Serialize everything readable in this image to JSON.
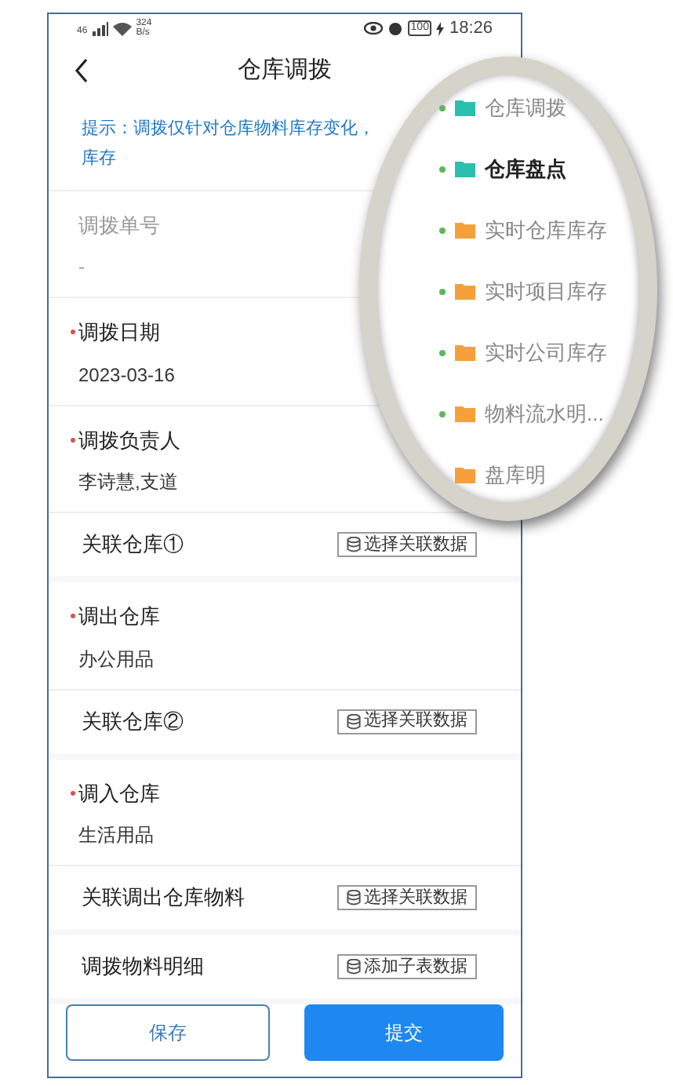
{
  "status_bar": {
    "network": "46",
    "speed_value": "324",
    "speed_unit": "B/s",
    "battery": "100",
    "time": "18:26"
  },
  "nav": {
    "title": "仓库调拨"
  },
  "hint": "提示：调拨仅针对仓库物料库存变化，库存",
  "rows": [
    {
      "kind": "field",
      "label": "调拨单号",
      "value": "-",
      "required": false,
      "disabled": true
    },
    {
      "kind": "field",
      "label": "调拨日期",
      "value": "2023-03-16",
      "required": true,
      "disabled": false
    },
    {
      "kind": "field",
      "label": "调拨负责人",
      "value": "李诗慧,支道",
      "required": true,
      "disabled": false
    },
    {
      "kind": "link",
      "label": "关联仓库①",
      "button": "选择关联数据"
    },
    {
      "kind": "field",
      "label": "调出仓库",
      "value": "办公用品",
      "required": true,
      "disabled": false
    },
    {
      "kind": "link",
      "label": "关联仓库②",
      "button": "选择关联数据"
    },
    {
      "kind": "field",
      "label": "调入仓库",
      "value": "生活用品",
      "required": true,
      "disabled": false
    },
    {
      "kind": "link",
      "label": "关联调出仓库物料",
      "button": "选择关联数据"
    },
    {
      "kind": "link",
      "label": "调拨物料明细",
      "button": "添加子表数据"
    }
  ],
  "actions": [
    {
      "label": "保存",
      "kind": "secondary"
    },
    {
      "label": "提交",
      "kind": "primary"
    }
  ],
  "magnifier": {
    "menu": [
      {
        "label": "仓库调拨",
        "color": "#2bbfae",
        "selected": false,
        "dot": true
      },
      {
        "label": "仓库盘点",
        "color": "#2bbfae",
        "selected": true,
        "dot": true
      },
      {
        "label": "实时仓库库存",
        "color": "#f5a03a",
        "selected": false,
        "dot": true
      },
      {
        "label": "实时项目库存",
        "color": "#f5a03a",
        "selected": false,
        "dot": true
      },
      {
        "label": "实时公司库存",
        "color": "#f5a03a",
        "selected": false,
        "dot": true
      },
      {
        "label": "物料流水明...",
        "color": "#f5a03a",
        "selected": false,
        "dot": true
      },
      {
        "label": "盘库明",
        "color": "#f5a03a",
        "selected": false,
        "dot": false
      }
    ]
  }
}
